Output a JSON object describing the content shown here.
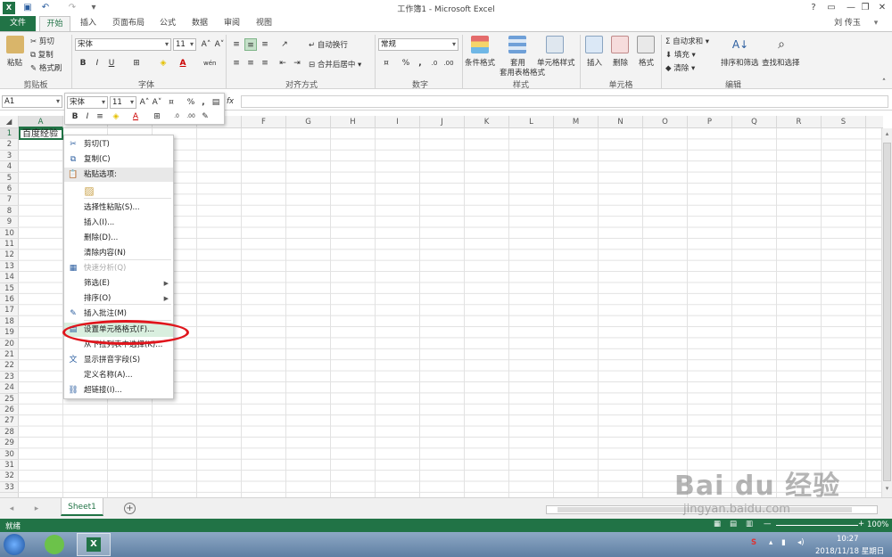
{
  "window": {
    "title": "工作簿1 - Microsoft Excel",
    "user": "刘 传玉",
    "help": "?",
    "min": "—",
    "restore": "❐",
    "close": "✕"
  },
  "tabs": [
    "文件",
    "开始",
    "插入",
    "页面布局",
    "公式",
    "数据",
    "审阅",
    "视图"
  ],
  "ribbon": {
    "clipboard": {
      "paste": "粘贴",
      "cut": "剪切",
      "copy": "复制",
      "format_painter": "格式刷",
      "label": "剪贴板"
    },
    "font": {
      "name": "宋体",
      "size": "11",
      "label": "字体",
      "bold": "B",
      "italic": "I",
      "underline": "U",
      "grow": "A˄",
      "shrink": "A˅",
      "phonetic": "wén"
    },
    "alignment": {
      "wrap": "自动换行",
      "merge": "合并后居中",
      "label": "对齐方式"
    },
    "number": {
      "format": "常规",
      "percent": "%",
      "comma": ",",
      "label": "数字"
    },
    "styles": {
      "conditional": "条件格式",
      "table": "套用表格格式",
      "cell_styles": "单元格样式",
      "label": "样式"
    },
    "cells": {
      "insert": "插入",
      "delete": "删除",
      "format": "格式",
      "label": "单元格"
    },
    "editing": {
      "autosum": "自动求和",
      "fill": "填充",
      "clear": "清除",
      "sort": "排序和筛选",
      "find": "查找和选择",
      "label": "编辑"
    }
  },
  "formula_bar": {
    "name_box": "A1",
    "fx": "fx"
  },
  "mini_toolbar": {
    "font": "宋体",
    "size": "11",
    "bold": "B",
    "italic": "I",
    "percent": "%",
    "comma": ","
  },
  "columns": [
    "A",
    "B",
    "C",
    "D",
    "E",
    "F",
    "G",
    "H",
    "I",
    "J",
    "K",
    "L",
    "M",
    "N",
    "O",
    "P",
    "Q",
    "R",
    "S"
  ],
  "rows": [
    "1",
    "2",
    "3",
    "4",
    "5",
    "6",
    "7",
    "8",
    "9",
    "10",
    "11",
    "12",
    "13",
    "14",
    "15",
    "16",
    "17",
    "18",
    "19",
    "20",
    "21",
    "22",
    "23",
    "24",
    "25",
    "26",
    "27",
    "28",
    "29",
    "30",
    "31",
    "32",
    "33"
  ],
  "cell_a1": "百度经验",
  "context_menu": [
    {
      "label": "剪切(T)",
      "icon": "scissors-icon"
    },
    {
      "label": "复制(C)",
      "icon": "copy-icon"
    },
    {
      "label": "粘贴选项:",
      "icon": "paste-icon",
      "header": true
    },
    {
      "label": "",
      "icon": "paste-clipboard-icon"
    },
    {
      "label": "选择性粘贴(S)...",
      "icon": ""
    },
    {
      "label": "插入(I)...",
      "icon": ""
    },
    {
      "label": "删除(D)...",
      "icon": ""
    },
    {
      "label": "清除内容(N)",
      "icon": ""
    },
    {
      "label": "快速分析(Q)",
      "icon": "quick-analysis-icon",
      "disabled": true
    },
    {
      "label": "筛选(E)",
      "icon": "",
      "submenu": true
    },
    {
      "label": "排序(O)",
      "icon": "",
      "submenu": true
    },
    {
      "label": "插入批注(M)",
      "icon": "comment-icon"
    },
    {
      "label": "设置单元格格式(F)...",
      "icon": "format-cells-icon",
      "highlight": true
    },
    {
      "label": "从下拉列表中选择(K)...",
      "icon": ""
    },
    {
      "label": "显示拼音字段(S)",
      "icon": "phonetic-icon"
    },
    {
      "label": "定义名称(A)...",
      "icon": ""
    },
    {
      "label": "超链接(I)...",
      "icon": "hyperlink-icon"
    }
  ],
  "sheet_tab": "Sheet1",
  "status": {
    "ready": "就绪",
    "zoom": "100%"
  },
  "taskbar": {
    "time": "10:27",
    "date": "2018/11/18 星期日"
  },
  "watermark": {
    "brand": "Bai du 经验",
    "url": "jingyan.baidu.com"
  },
  "colors": {
    "excel_green": "#217346",
    "highlight_red": "#e0151c"
  }
}
